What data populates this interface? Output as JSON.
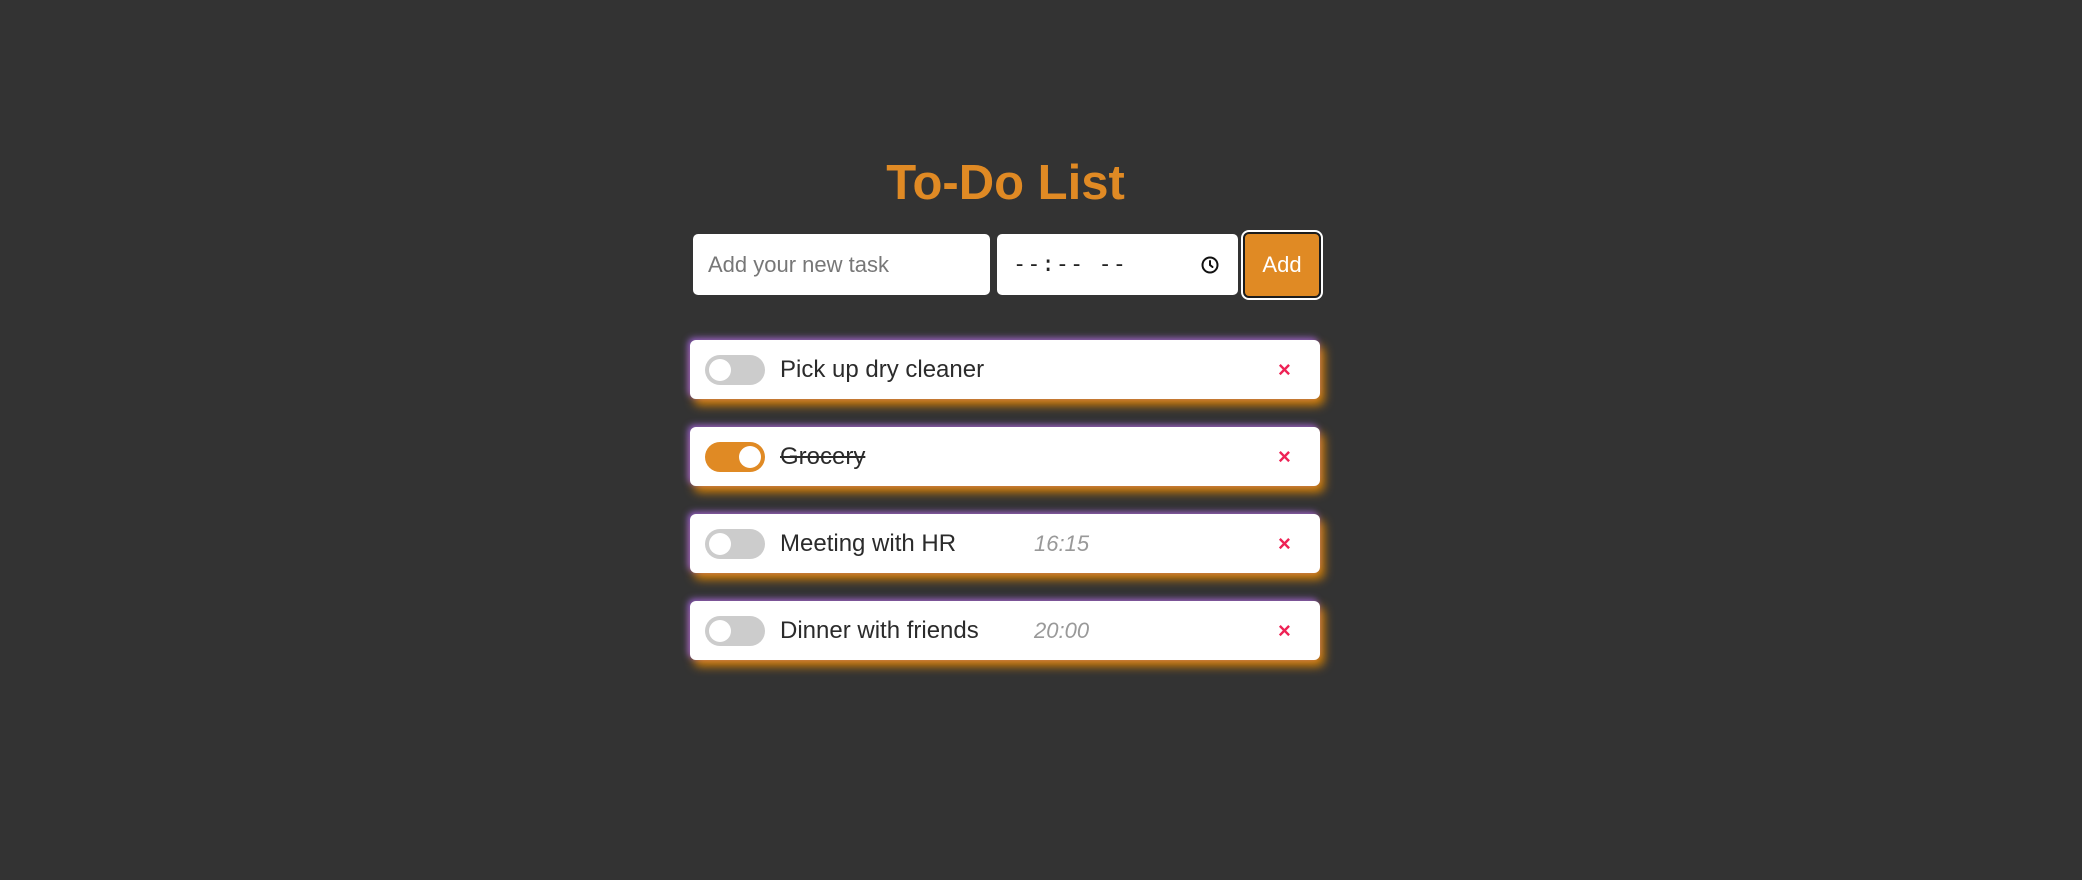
{
  "title": "To-Do List",
  "form": {
    "task_placeholder": "Add your new task",
    "time_placeholder": "--:-- --",
    "add_label": "Add"
  },
  "colors": {
    "background": "#333333",
    "accent": "#e08a24",
    "delete": "#ee2255",
    "toggle_off": "#cccccc"
  },
  "icons": {
    "time_field": "clock-icon",
    "delete": "close-icon"
  },
  "tasks": [
    {
      "text": "Pick up dry cleaner",
      "time": "",
      "completed": false,
      "delete_label": "×"
    },
    {
      "text": "Grocery",
      "time": "",
      "completed": true,
      "delete_label": "×"
    },
    {
      "text": "Meeting with HR",
      "time": "16:15",
      "completed": false,
      "delete_label": "×"
    },
    {
      "text": "Dinner with friends",
      "time": "20:00",
      "completed": false,
      "delete_label": "×"
    }
  ]
}
